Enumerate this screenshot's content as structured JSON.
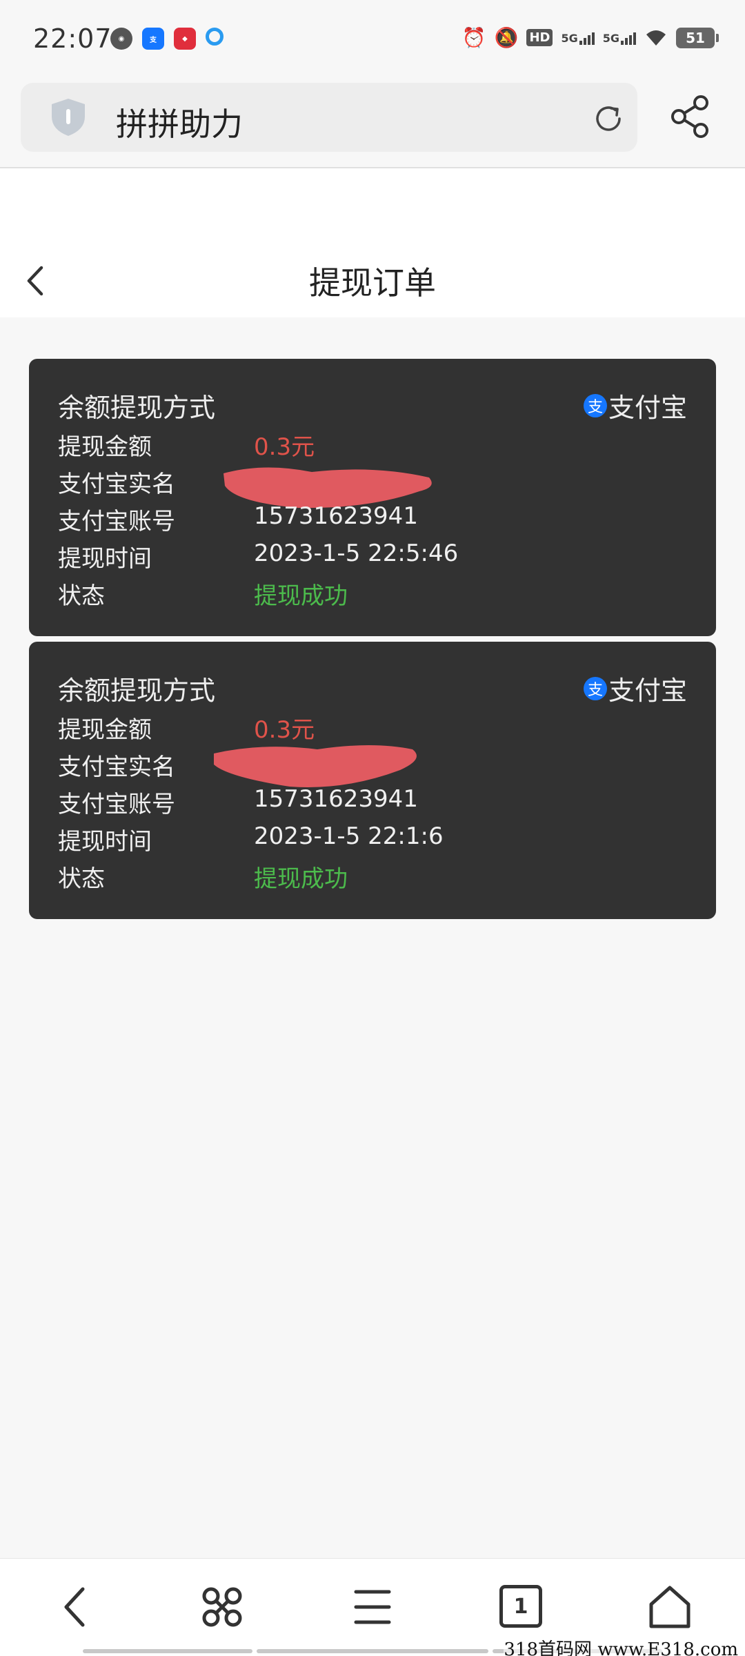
{
  "status_bar": {
    "time": "22:07",
    "network_1": "5G",
    "network_2": "5G",
    "battery": "51"
  },
  "browser": {
    "site_title": "拼拼助力"
  },
  "header": {
    "title": "提现订单"
  },
  "orders": [
    {
      "title": "余额提现方式",
      "method": "支付宝",
      "amount_label": "提现金额",
      "amount": "0.3元",
      "name_label": "支付宝实名",
      "name": "",
      "account_label": "支付宝账号",
      "account": "15731623941",
      "time_label": "提现时间",
      "time": "2023-1-5 22:5:46",
      "status_label": "状态",
      "status": "提现成功"
    },
    {
      "title": "余额提现方式",
      "method": "支付宝",
      "amount_label": "提现金额",
      "amount": "0.3元",
      "name_label": "支付宝实名",
      "name": "",
      "account_label": "支付宝账号",
      "account": "15731623941",
      "time_label": "提现时间",
      "time": "2023-1-5 22:1:6",
      "status_label": "状态",
      "status": "提现成功"
    }
  ],
  "colors": {
    "card_bg": "#323232",
    "amount": "#e0534a",
    "status_success": "#4cbb4c",
    "redaction": "#e05a60"
  },
  "bottom_nav": {
    "tab_count": "1"
  },
  "watermark": "318首码网 www.E318.com"
}
